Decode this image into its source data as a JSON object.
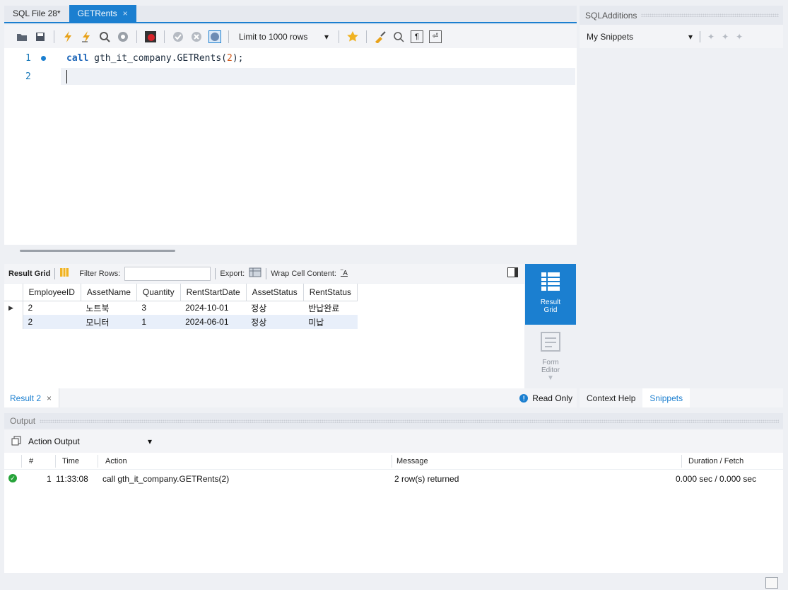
{
  "editor_tabs": [
    {
      "label": "SQL File 28*"
    },
    {
      "label": "GETRents",
      "close": "×"
    }
  ],
  "toolbar": {
    "limit_label": "Limit to 1000 rows"
  },
  "editor": {
    "lines": [
      "1",
      "2"
    ],
    "code_keyword": "call",
    "code_body": " gth_it_company.GETRents(",
    "code_arg": "2",
    "code_end": ");"
  },
  "result": {
    "grid_label": "Result Grid",
    "filter_label": "Filter Rows:",
    "export_label": "Export:",
    "wrap_label": "Wrap Cell Content:",
    "columns": [
      "EmployeeID",
      "AssetName",
      "Quantity",
      "RentStartDate",
      "AssetStatus",
      "RentStatus"
    ],
    "rows": [
      [
        "2",
        "노트북",
        "3",
        "2024-10-01",
        "정상",
        "반납완료"
      ],
      [
        "2",
        "모니터",
        "1",
        "2024-06-01",
        "정상",
        "미납"
      ]
    ],
    "side_result_grid": "Result Grid",
    "side_form_editor": "Form Editor",
    "result_tab": "Result 2",
    "result_tab_close": "×",
    "read_only": "Read Only"
  },
  "sql_additions": {
    "title": "SQLAdditions",
    "snippets_select": "My Snippets",
    "tab_context_help": "Context Help",
    "tab_snippets": "Snippets"
  },
  "output": {
    "title": "Output",
    "select_value": "Action Output",
    "columns": {
      "num": "#",
      "time": "Time",
      "action": "Action",
      "message": "Message",
      "duration": "Duration / Fetch"
    },
    "rows": [
      {
        "num": "1",
        "time": "11:33:08",
        "action": "call gth_it_company.GETRents(2)",
        "message": "2 row(s) returned",
        "duration": "0.000 sec / 0.000 sec"
      }
    ]
  },
  "colors": {
    "accent": "#1b7fd0",
    "ok": "#27a33a"
  }
}
